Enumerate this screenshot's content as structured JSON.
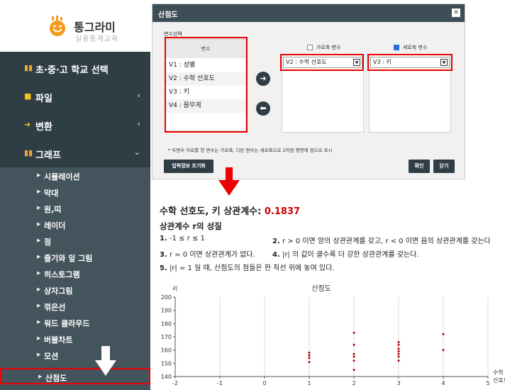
{
  "logo": {
    "title": "통그라미",
    "subtitle": "실용통계교육",
    "icon": "smiley-bars-logo"
  },
  "sidebar": {
    "menu": [
      {
        "label": "초·중·고 학교 선택",
        "icon": "bar-chart-icon",
        "expandable": false
      },
      {
        "label": "파일",
        "icon": "folder-icon",
        "expandable": true
      },
      {
        "label": "변환",
        "icon": "arrow-right-icon",
        "expandable": true
      },
      {
        "label": "그래프",
        "icon": "graph-icon",
        "expandable": true,
        "expanded": true
      }
    ],
    "graph_items": [
      "시뮬레이션",
      "막대",
      "원,띠",
      "레이더",
      "점",
      "줄기와 잎 그림",
      "히스토그램",
      "상자그림",
      "꺾은선",
      "워드 클라우드",
      "버블차트",
      "모션",
      "산점도"
    ],
    "active_item": "산점도"
  },
  "dialog": {
    "title": "산점도",
    "section_label": "변수선택",
    "var_header": "변수",
    "variables": [
      "V1 : 성별",
      "V2 : 수학 선호도",
      "V3 : 키",
      "V4 : 몸무게"
    ],
    "x_axis_label": "가로축 변수",
    "y_axis_label": "세로축 변수",
    "x_checked": false,
    "y_checked": true,
    "x_selected": "V2 : 수학 선호도",
    "y_selected": "V3 : 키",
    "note": "* 두변수 자료를 한 변수는 가로축, 다른 변수는 세로축으로 2차원 평면에 점으로 표시",
    "reset_button": "입력정보 초기화",
    "ok_button": "확인",
    "close_button": "닫기"
  },
  "result": {
    "title_prefix": "수학 선호도, 키 상관계수:",
    "correlation": "0.1837",
    "props_title": "상관계수 r의 성질",
    "props": [
      {
        "num": "1.",
        "text": "-1 ≤ r ≤ 1"
      },
      {
        "num": "2.",
        "text": "r > 0 이면 양의 상관관계를 갖고, r < 0 이면 음의 상관관계를 갖는다"
      },
      {
        "num": "3.",
        "text": "r = 0 이면 상관관계가 없다."
      },
      {
        "num": "4.",
        "text": "|r| 의 값이 클수록 더 강한 상관관계를 갖는다."
      },
      {
        "num": "5.",
        "text": "|r| = 1 일 때, 산점도의 점들은 한 직선 위에 놓여 있다."
      }
    ]
  },
  "colors": {
    "sidebar": "#2f3e45",
    "submenu": "#44545c",
    "highlight": "#e00000",
    "point": "#b00000",
    "accent": "#2b6fd6"
  },
  "chart_data": {
    "type": "scatter",
    "title": "산점도",
    "xlabel": "수학 선호도",
    "ylabel": "키",
    "xlim": [
      -2,
      5
    ],
    "ylim": [
      140,
      200
    ],
    "x_ticks": [
      "-2",
      "-1",
      "0",
      "1",
      "2",
      "3",
      "4",
      "5"
    ],
    "y_ticks": [
      "140",
      "150",
      "160",
      "170",
      "180",
      "190",
      "200"
    ],
    "grid": "vertical",
    "points": [
      {
        "x": 1,
        "y": 151
      },
      {
        "x": 1,
        "y": 154
      },
      {
        "x": 1,
        "y": 156
      },
      {
        "x": 1,
        "y": 158
      },
      {
        "x": 2,
        "y": 145
      },
      {
        "x": 2,
        "y": 152
      },
      {
        "x": 2,
        "y": 155
      },
      {
        "x": 2,
        "y": 157
      },
      {
        "x": 2,
        "y": 164
      },
      {
        "x": 2,
        "y": 173
      },
      {
        "x": 3,
        "y": 152
      },
      {
        "x": 3,
        "y": 155
      },
      {
        "x": 3,
        "y": 157
      },
      {
        "x": 3,
        "y": 159
      },
      {
        "x": 3,
        "y": 161
      },
      {
        "x": 3,
        "y": 164
      },
      {
        "x": 3,
        "y": 166
      },
      {
        "x": 4,
        "y": 160
      },
      {
        "x": 4,
        "y": 172
      }
    ]
  }
}
